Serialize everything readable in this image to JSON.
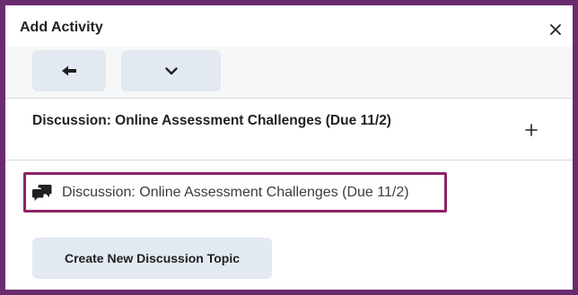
{
  "dialog": {
    "title": "Add Activity",
    "close_icon": "close-icon"
  },
  "toolbar": {
    "back_icon": "arrow-left-icon",
    "menu_icon": "chevron-down-icon"
  },
  "topic": {
    "title": "Discussion: Online Assessment Challenges (Due 11/2)",
    "add_icon": "plus-icon"
  },
  "linked_item": {
    "icon": "discussion-icon",
    "label": "Discussion: Online Assessment Challenges (Due 11/2)",
    "highlight_color": "#8c2466"
  },
  "create_button": {
    "label": "Create New Discussion Topic"
  },
  "colors": {
    "frame_border": "#6b2c6f",
    "button_bg": "#e3e9f1",
    "toolbar_bg": "#f6f7f8"
  }
}
